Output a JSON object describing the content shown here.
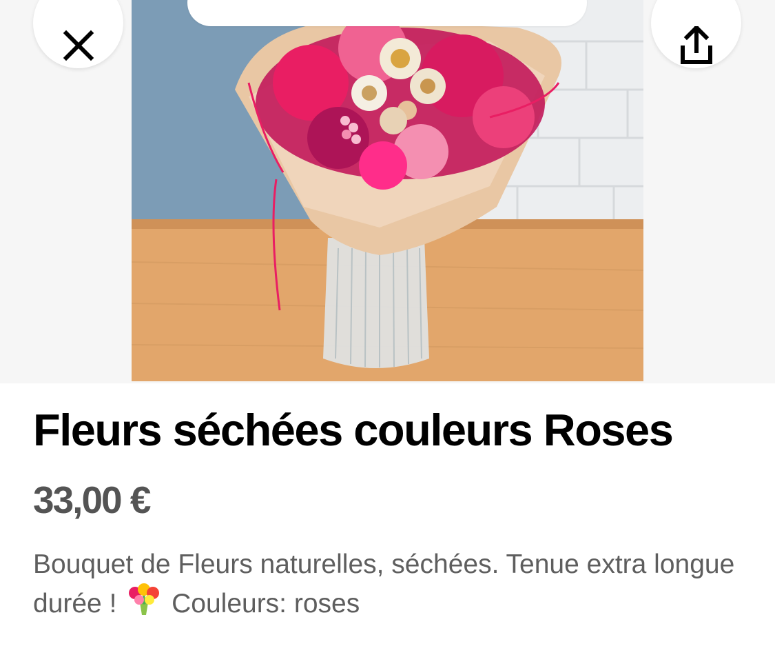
{
  "header": {
    "close_icon": "close-icon",
    "share_icon": "share-icon"
  },
  "product": {
    "image_alt": "Bouquet de fleurs séchées roses dans un vase en verre",
    "title": "Fleurs séchées couleurs Roses",
    "price": "33,00 €",
    "description_part1": "Bouquet de Fleurs naturelles, séchées. Tenue extra longue durée !",
    "description_emoji": "bouquet-emoji",
    "description_part2": "Couleurs: roses"
  },
  "colors": {
    "title": "#000000",
    "price": "#545454",
    "description": "#5e5e5e",
    "hero_background": "#f6f6f6"
  }
}
